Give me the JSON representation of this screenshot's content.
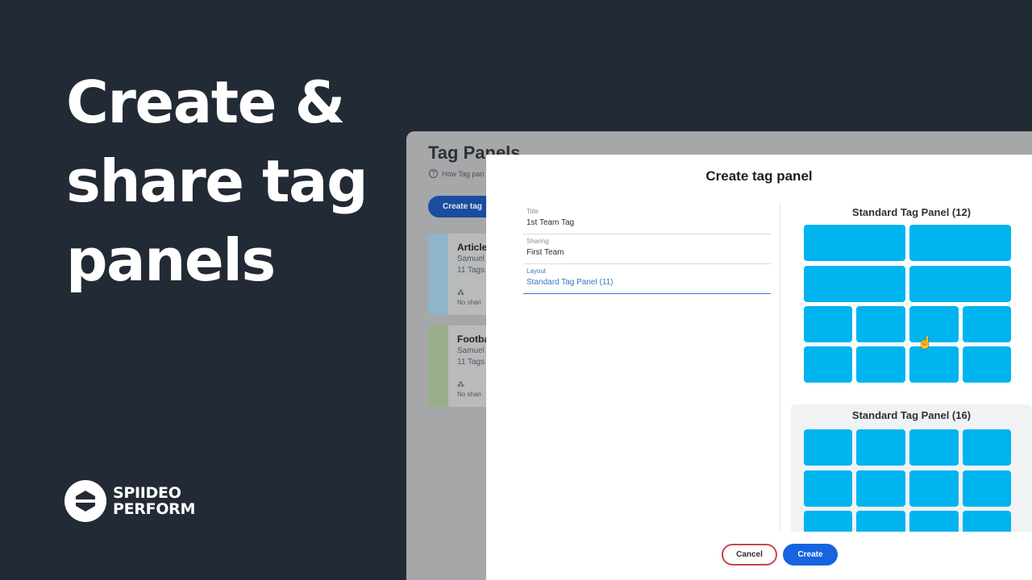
{
  "headline": {
    "line1": "Create &",
    "line2": "share tag",
    "line3": "panels"
  },
  "brand": {
    "line1": "SPIIDEO",
    "line2": "PERFORM"
  },
  "background_app": {
    "page_title": "Tag Panels",
    "help_text": "How Tag pan",
    "create_button": "Create tag",
    "cards": [
      {
        "title": "Article",
        "owner": "Samuel",
        "count": "11 Tags",
        "sharing": "No shari",
        "color": "#8fb5c8"
      },
      {
        "title": "Footba",
        "owner": "Samuel",
        "count": "11 Tags",
        "sharing": "No shari",
        "color": "#98ae8a"
      }
    ]
  },
  "modal": {
    "title": "Create tag panel",
    "fields": [
      {
        "label": "Title",
        "value": "1st Team Tag"
      },
      {
        "label": "Sharing",
        "value": "First Team"
      },
      {
        "label": "Layout",
        "value": "Standard Tag Panel (11)"
      }
    ],
    "layouts": [
      {
        "name": "Standard Tag Panel (12)"
      },
      {
        "name": "Standard Tag Panel (16)"
      }
    ],
    "cancel_label": "Cancel",
    "create_label": "Create"
  },
  "colors": {
    "tile": "#00b4f0",
    "primary": "#1763e0",
    "danger": "#c9444c",
    "page_bg": "#222a35"
  }
}
